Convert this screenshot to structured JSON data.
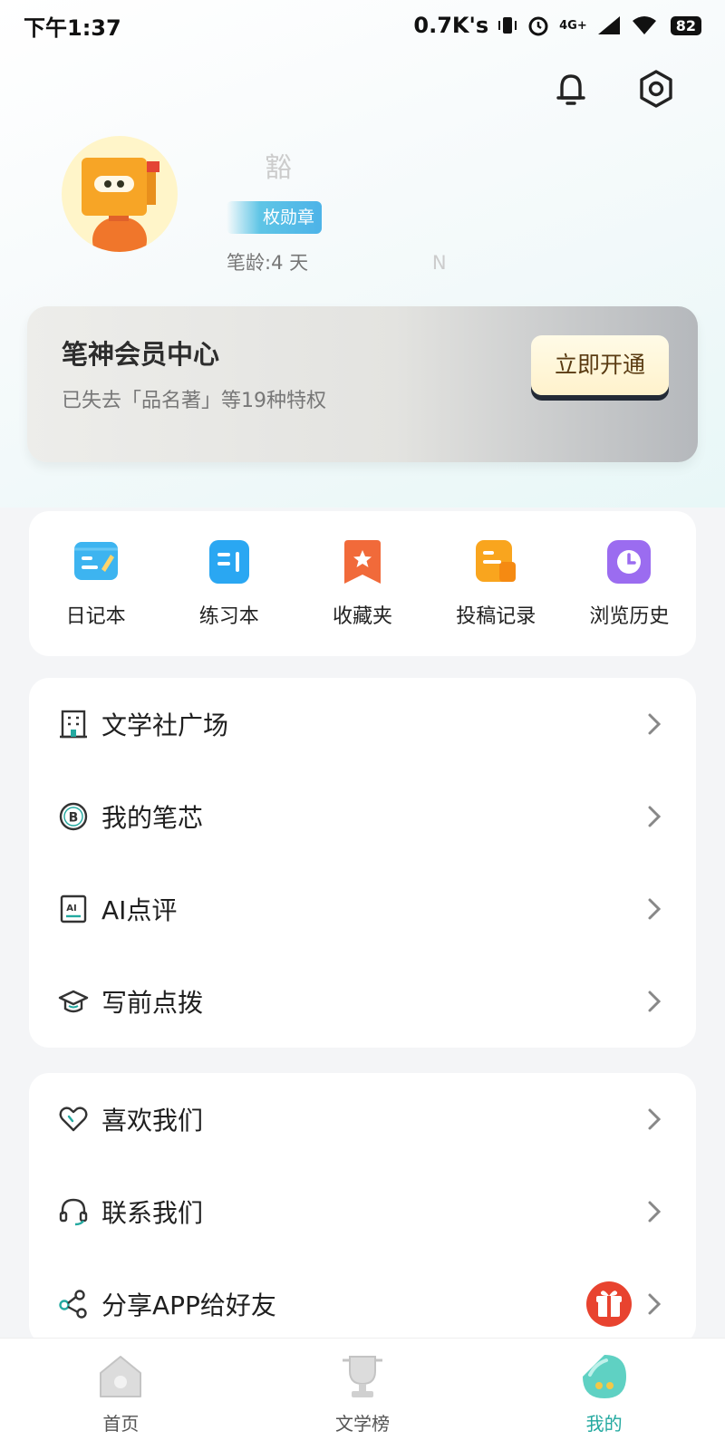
{
  "status_bar": {
    "time": "下午1:37",
    "net_speed": "0.7K's",
    "network": "4G+",
    "battery": "82"
  },
  "header": {
    "icons": [
      "bell-icon",
      "gear-icon"
    ]
  },
  "profile": {
    "username": "豁",
    "badge": "枚勋章",
    "age": "笔龄:4 天",
    "extra": "N"
  },
  "member": {
    "title": "笔神会员中心",
    "subtitle": "已失去「品名著」等19种特权",
    "button": "立即开通"
  },
  "tools": [
    {
      "label": "日记本",
      "icon": "diary-icon",
      "color": "#3db4f0"
    },
    {
      "label": "练习本",
      "icon": "notebook-icon",
      "color": "#2aa7f2"
    },
    {
      "label": "收藏夹",
      "icon": "bookmark-icon",
      "color": "#f16a3a"
    },
    {
      "label": "投稿记录",
      "icon": "submission-icon",
      "color": "#f9a51e"
    },
    {
      "label": "浏览历史",
      "icon": "history-icon",
      "color": "#9b6cf0"
    }
  ],
  "menu1": [
    {
      "label": "文学社广场",
      "icon": "building-icon"
    },
    {
      "label": "我的笔芯",
      "icon": "coin-b-icon"
    },
    {
      "label": "AI点评",
      "icon": "ai-review-icon"
    },
    {
      "label": "写前点拨",
      "icon": "graduation-cap-icon"
    }
  ],
  "menu2": [
    {
      "label": "喜欢我们",
      "icon": "heart-icon"
    },
    {
      "label": "联系我们",
      "icon": "headset-icon"
    },
    {
      "label": "分享APP给好友",
      "icon": "share-icon"
    }
  ],
  "nav": {
    "items": [
      {
        "label": "首页",
        "icon": "home-icon"
      },
      {
        "label": "文学榜",
        "icon": "trophy-icon"
      },
      {
        "label": "我的",
        "icon": "profile-icon"
      }
    ],
    "active": "我的",
    "accent": "#23a9a0"
  }
}
